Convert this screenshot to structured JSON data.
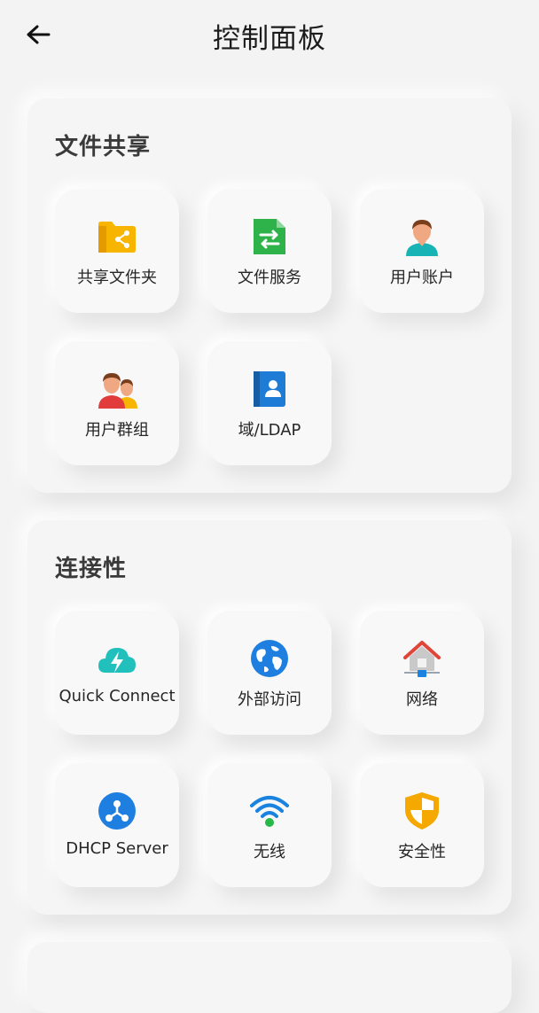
{
  "header": {
    "title": "控制面板"
  },
  "sections": [
    {
      "title": "文件共享",
      "items": [
        {
          "label": "共享文件夹",
          "icon": "shared-folder-icon"
        },
        {
          "label": "文件服务",
          "icon": "file-services-icon"
        },
        {
          "label": "用户账户",
          "icon": "user-account-icon"
        },
        {
          "label": "用户群组",
          "icon": "user-group-icon"
        },
        {
          "label": "域/LDAP",
          "icon": "domain-ldap-icon"
        }
      ]
    },
    {
      "title": "连接性",
      "items": [
        {
          "label": "Quick Connect",
          "icon": "quick-connect-icon"
        },
        {
          "label": "外部访问",
          "icon": "globe-icon"
        },
        {
          "label": "网络",
          "icon": "network-house-icon"
        },
        {
          "label": "DHCP Server",
          "icon": "dhcp-server-icon"
        },
        {
          "label": "无线",
          "icon": "wifi-icon"
        },
        {
          "label": "安全性",
          "icon": "security-shield-icon"
        }
      ]
    }
  ],
  "colors": {
    "background": "#f3f3f3",
    "folder": "#f7b500",
    "file_green": "#2db34a",
    "user_skin": "#f0a882",
    "user_shirt": "#17b3b5",
    "ldap_blue": "#1e7bd6",
    "cloud_teal": "#22c0bd",
    "globe_blue": "#1f7fe0",
    "house_red": "#e0453a",
    "wifi_blue": "#1a83e0",
    "wifi_dot": "#27b84a",
    "shield_orange": "#f5a800"
  }
}
